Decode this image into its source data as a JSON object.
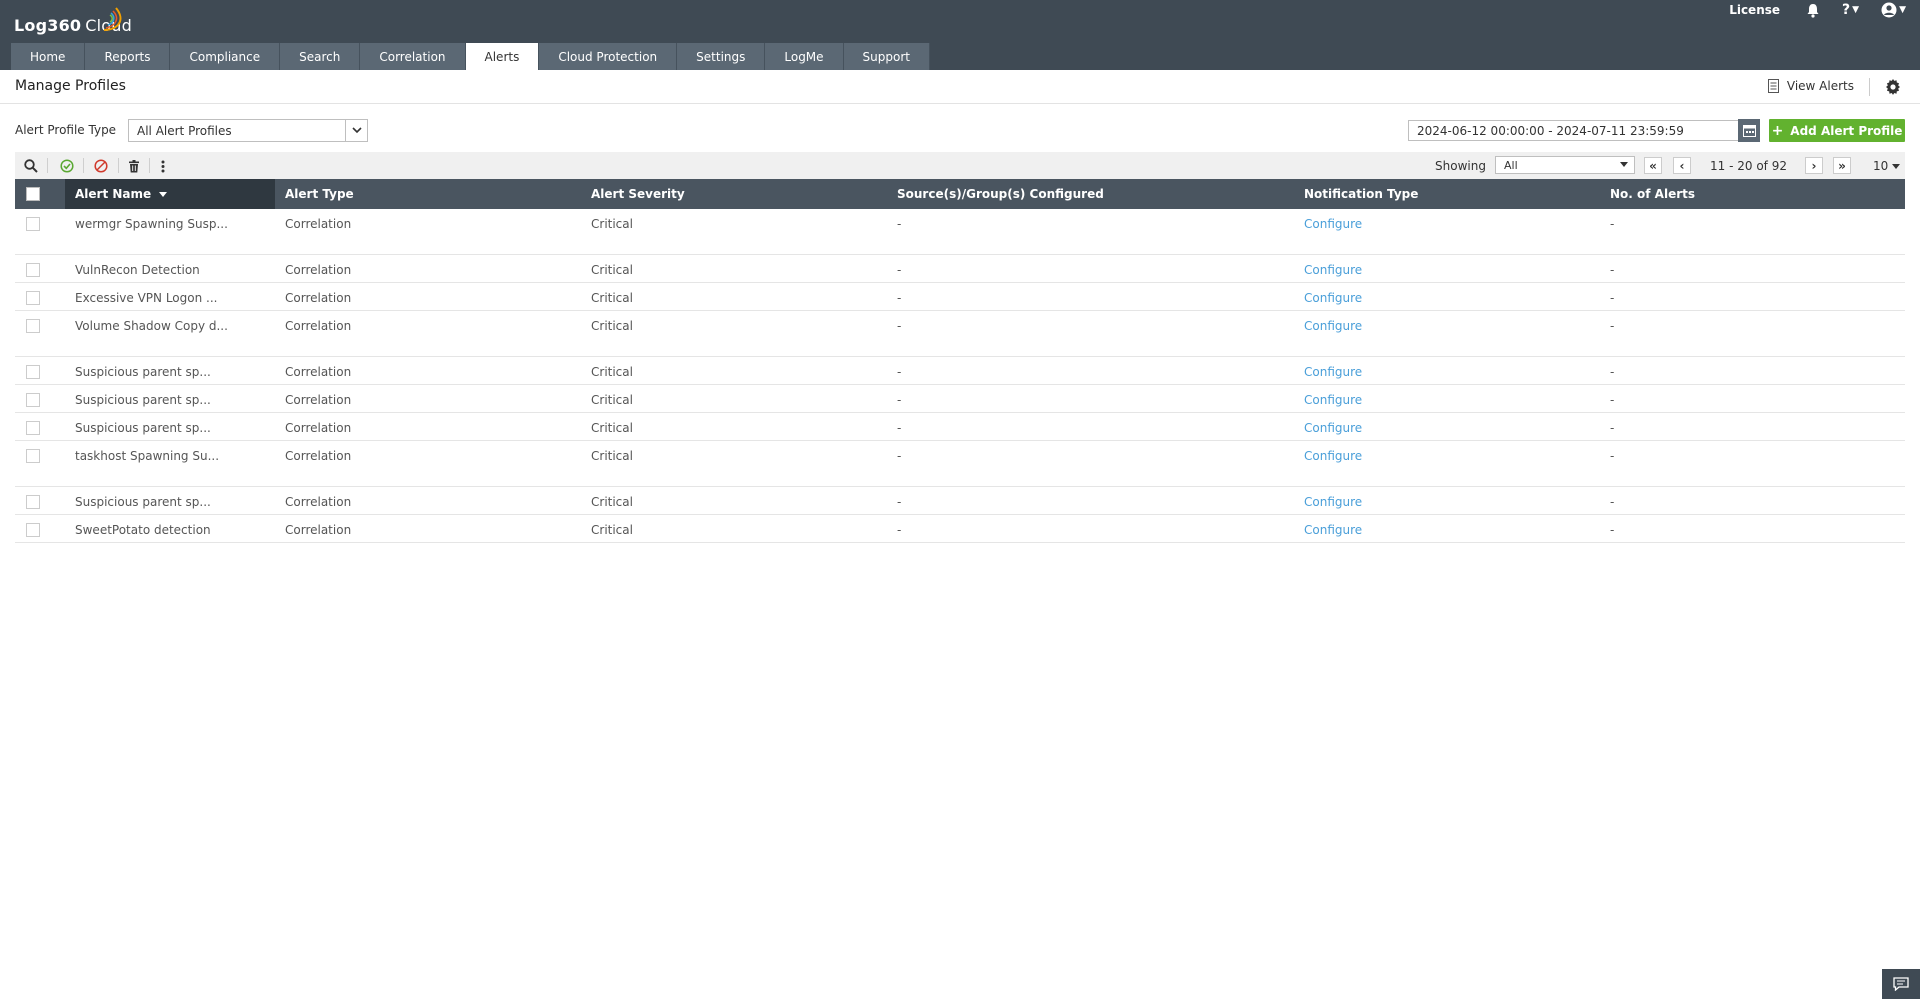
{
  "app": {
    "logo": "Log360",
    "logo_suffix": "Cloud",
    "license_label": "License",
    "help_label": "?"
  },
  "nav": {
    "tabs": [
      {
        "label": "Home"
      },
      {
        "label": "Reports"
      },
      {
        "label": "Compliance"
      },
      {
        "label": "Search"
      },
      {
        "label": "Correlation"
      },
      {
        "label": "Alerts"
      },
      {
        "label": "Cloud Protection"
      },
      {
        "label": "Settings"
      },
      {
        "label": "LogMe"
      },
      {
        "label": "Support"
      }
    ],
    "active_tab": "Alerts"
  },
  "page": {
    "title": "Manage Profiles",
    "view_alerts_label": "View Alerts"
  },
  "filters": {
    "profile_type_label": "Alert Profile Type",
    "profile_type_value": "All Alert Profiles",
    "date_range": "2024-06-12 00:00:00 - 2024-07-11 23:59:59",
    "add_button_label": "Add Alert Profile"
  },
  "toolbar": {
    "showing_label": "Showing",
    "showing_value": "All",
    "page_info": "11 - 20 of 92",
    "per_page": "10"
  },
  "table": {
    "columns": [
      "Alert Name",
      "Alert Type",
      "Alert Severity",
      "Source(s)/Group(s) Configured",
      "Notification Type",
      "No. of Alerts"
    ],
    "rows": [
      {
        "name": "wermgr Spawning Susp...",
        "type": "Correlation",
        "severity": "Critical",
        "sources": "-",
        "notification": "Configure",
        "count": "-"
      },
      {
        "name": "VulnRecon Detection",
        "type": "Correlation",
        "severity": "Critical",
        "sources": "-",
        "notification": "Configure",
        "count": "-"
      },
      {
        "name": "Excessive VPN Logon ...",
        "type": "Correlation",
        "severity": "Critical",
        "sources": "-",
        "notification": "Configure",
        "count": "-"
      },
      {
        "name": "Volume Shadow Copy d...",
        "type": "Correlation",
        "severity": "Critical",
        "sources": "-",
        "notification": "Configure",
        "count": "-"
      },
      {
        "name": "Suspicious parent sp...",
        "type": "Correlation",
        "severity": "Critical",
        "sources": "-",
        "notification": "Configure",
        "count": "-"
      },
      {
        "name": "Suspicious parent sp...",
        "type": "Correlation",
        "severity": "Critical",
        "sources": "-",
        "notification": "Configure",
        "count": "-"
      },
      {
        "name": "Suspicious parent sp...",
        "type": "Correlation",
        "severity": "Critical",
        "sources": "-",
        "notification": "Configure",
        "count": "-"
      },
      {
        "name": "taskhost Spawning Su...",
        "type": "Correlation",
        "severity": "Critical",
        "sources": "-",
        "notification": "Configure",
        "count": "-"
      },
      {
        "name": "Suspicious parent sp...",
        "type": "Correlation",
        "severity": "Critical",
        "sources": "-",
        "notification": "Configure",
        "count": "-"
      },
      {
        "name": "SweetPotato detection",
        "type": "Correlation",
        "severity": "Critical",
        "sources": "-",
        "notification": "Configure",
        "count": "-"
      }
    ]
  },
  "colors": {
    "header_bg": "#3f4a54",
    "tab_bg": "#5b6874",
    "table_header_bg": "#4a5560",
    "add_button": "#62b22f",
    "link": "#4a9fd9"
  }
}
